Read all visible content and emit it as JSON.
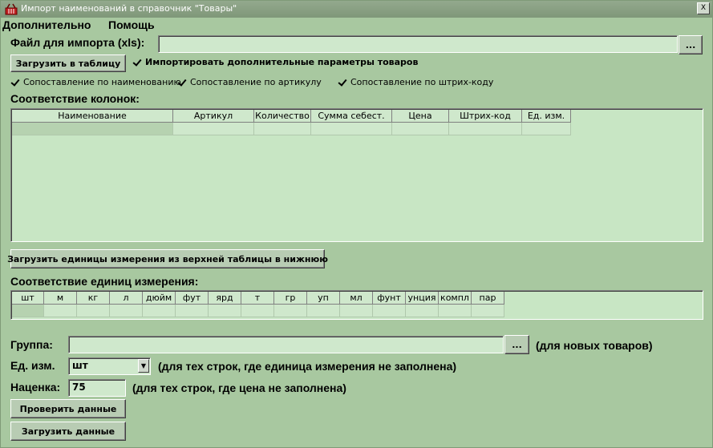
{
  "window": {
    "title": "Импорт наименований в справочник \"Товары\"",
    "close_label": "X"
  },
  "menu": [
    "Дополнительно",
    "Помощь"
  ],
  "file": {
    "label": "Файл для импорта (xls):",
    "value": "",
    "browse_label": "..."
  },
  "actions": {
    "load_table": "Загрузить в таблицу",
    "import_extra": "Импортировать дополнительные параметры товаров",
    "load_units": "Загрузить единицы измерения из верхней таблицы в нижнюю",
    "check": "Проверить данные",
    "load_data": "Загрузить данные"
  },
  "matching": {
    "by_name": "Сопоставление по наименованию",
    "by_article": "Сопоставление по артикулу",
    "by_barcode": "Сопоставление по штрих-коду"
  },
  "columns": {
    "title": "Соответствие колонок:",
    "headers": [
      "Наименование",
      "Артикул",
      "Количество",
      "Сумма себест.",
      "Цена",
      "Штрих-код",
      "Ед. изм."
    ]
  },
  "units": {
    "title": "Соответствие единиц измерения:",
    "headers": [
      "шт",
      "м",
      "кг",
      "л",
      "дюйм",
      "фут",
      "ярд",
      "т",
      "гр",
      "уп",
      "мл",
      "фунт",
      "унция",
      "компл",
      "пар"
    ]
  },
  "group": {
    "label": "Группа:",
    "value": "",
    "browse_label": "...",
    "note": "(для новых товаров)"
  },
  "unit": {
    "label": "Ед. изм.",
    "value": "шт",
    "note": "(для тех строк, где единица измерения не заполнена)"
  },
  "markup": {
    "label": "Наценка:",
    "value": "75",
    "note": "(для тех строк, где цена не заполнена)"
  }
}
